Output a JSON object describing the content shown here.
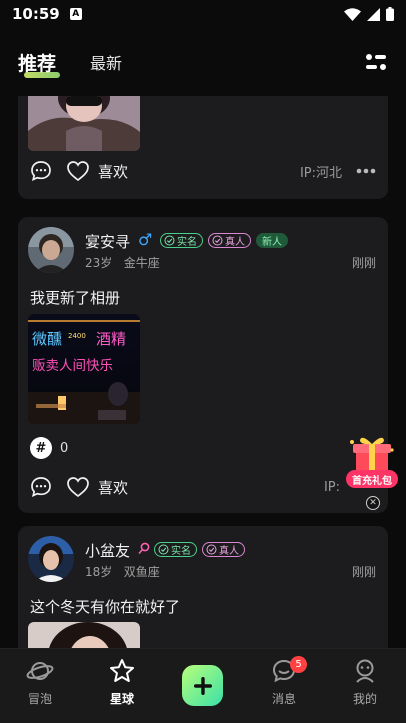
{
  "status": {
    "time": "10:59",
    "notif_letter": "A"
  },
  "header": {
    "tabs": [
      "推荐",
      "最新"
    ]
  },
  "posts": [
    {
      "like_label": "喜欢",
      "ip": "IP:河北"
    },
    {
      "name": "宴安寻",
      "gender": "♂",
      "badges": {
        "real": "实名",
        "person": "真人",
        "new": "新人"
      },
      "age": "23岁",
      "zodiac": "金牛座",
      "time": "刚刚",
      "text": "我更新了相册",
      "photo_text": {
        "line1": "微醺",
        "line2": "酒精",
        "line3": "贩卖人间快乐",
        "small": "2400"
      },
      "topic_count": "0",
      "like_label": "喜欢",
      "ip": "IP:"
    },
    {
      "name": "小盆友",
      "badges": {
        "real": "实名",
        "person": "真人"
      },
      "age": "18岁",
      "zodiac": "双鱼座",
      "time": "刚刚",
      "text": "这个冬天有你在就好了"
    }
  ],
  "gift": {
    "label": "首充礼包"
  },
  "nav": {
    "items": [
      "冒泡",
      "星球",
      "消息",
      "我的"
    ],
    "msg_badge": "5"
  },
  "colors": {
    "accent_green": "#4bd08a",
    "accent_pink": "#d887d0",
    "gender_blue": "#3ea8ff",
    "badge_red": "#ff4141"
  }
}
